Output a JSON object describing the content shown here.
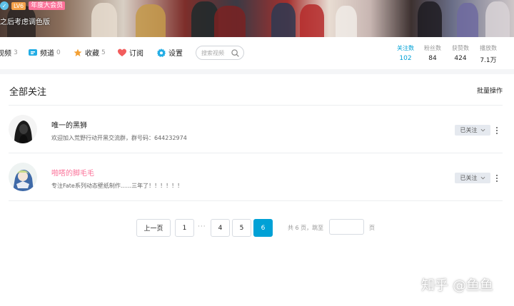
{
  "banner": {
    "level_badge": "LV6",
    "vip_badge": "年度大会员",
    "signature": "之后考虑调色版"
  },
  "nav": {
    "items": [
      {
        "name": "contribute",
        "label": "视频",
        "count": "3",
        "icon": "video-icon"
      },
      {
        "name": "channel",
        "label": "频道",
        "count": "0",
        "icon": "channel-icon"
      },
      {
        "name": "favorite",
        "label": "收藏",
        "count": "5",
        "icon": "star-icon"
      },
      {
        "name": "subscribe",
        "label": "订阅",
        "count": "",
        "icon": "heart-icon"
      },
      {
        "name": "settings",
        "label": "设置",
        "count": "",
        "icon": "gear-icon"
      }
    ],
    "search_placeholder": "搜索视频",
    "stats": [
      {
        "label": "关注数",
        "value": "102"
      },
      {
        "label": "粉丝数",
        "value": "84"
      },
      {
        "label": "获赞数",
        "value": "424"
      },
      {
        "label": "播放数",
        "value": "7.1万"
      }
    ]
  },
  "panel": {
    "title": "全部关注",
    "batch_label": "批量操作",
    "follow_label": "已关注",
    "users": [
      {
        "name": "唯一的黑狮",
        "sign": "欢迎加入荒野行动开黑交流群，群号码：644232974",
        "highlight": false
      },
      {
        "name": "啪嗒的脚毛毛",
        "sign": "专注Fate系列动态壁纸制作......三年了！！！！！！",
        "highlight": true
      }
    ]
  },
  "pager": {
    "prev_label": "上一页",
    "pages": [
      "1",
      "4",
      "5",
      "6"
    ],
    "ellipsis": "···",
    "current": "6",
    "info": "共 6 页，跳至",
    "suffix": "页"
  },
  "watermark": "知乎 @鱼鱼",
  "colors": {
    "accent": "#00a1d6",
    "pink": "#fb7299"
  }
}
